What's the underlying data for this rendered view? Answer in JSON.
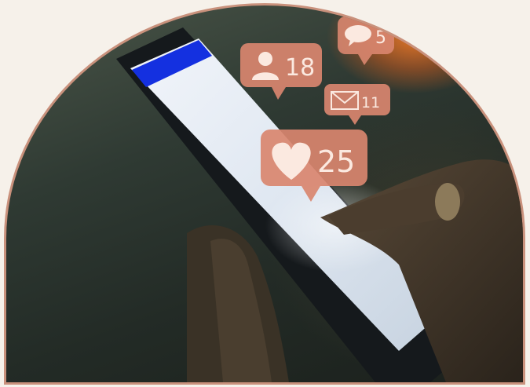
{
  "notifications": {
    "followers": {
      "count": "18",
      "icon": "person-icon"
    },
    "comments": {
      "count": "5",
      "icon": "speech-bubble-icon"
    },
    "messages": {
      "count": "11",
      "icon": "envelope-icon"
    },
    "likes": {
      "count": "25",
      "icon": "heart-icon"
    }
  },
  "colors": {
    "background": "#f6f1ea",
    "arch_border": "#c9917c",
    "bubble": "#d9866f",
    "screen_glow": "#e8eef5",
    "bokeh": "#e07a2c"
  }
}
